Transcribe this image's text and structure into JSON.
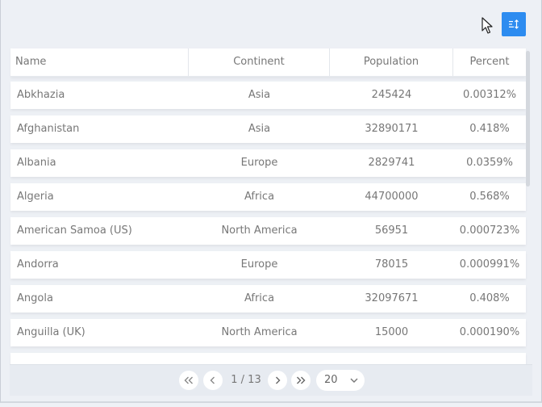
{
  "table": {
    "columns": [
      "Name",
      "Continent",
      "Population",
      "Percent"
    ],
    "rows": [
      {
        "name": "Abkhazia",
        "continent": "Asia",
        "population": "245424",
        "percent": "0.00312%"
      },
      {
        "name": "Afghanistan",
        "continent": "Asia",
        "population": "32890171",
        "percent": "0.418%"
      },
      {
        "name": "Albania",
        "continent": "Europe",
        "population": "2829741",
        "percent": "0.0359%"
      },
      {
        "name": "Algeria",
        "continent": "Africa",
        "population": "44700000",
        "percent": "0.568%"
      },
      {
        "name": "American Samoa (US)",
        "continent": "North America",
        "population": "56951",
        "percent": "0.000723%"
      },
      {
        "name": "Andorra",
        "continent": "Europe",
        "population": "78015",
        "percent": "0.000991%"
      },
      {
        "name": "Angola",
        "continent": "Africa",
        "population": "32097671",
        "percent": "0.408%"
      },
      {
        "name": "Anguilla (UK)",
        "continent": "North America",
        "population": "15000",
        "percent": "0.000190%"
      }
    ]
  },
  "pager": {
    "info": "1 / 13",
    "page_size": "20"
  },
  "toolbar": {
    "sort_icon": "sort-icon"
  },
  "colors": {
    "accent": "#2d8cf0",
    "background": "#eef1f6"
  }
}
